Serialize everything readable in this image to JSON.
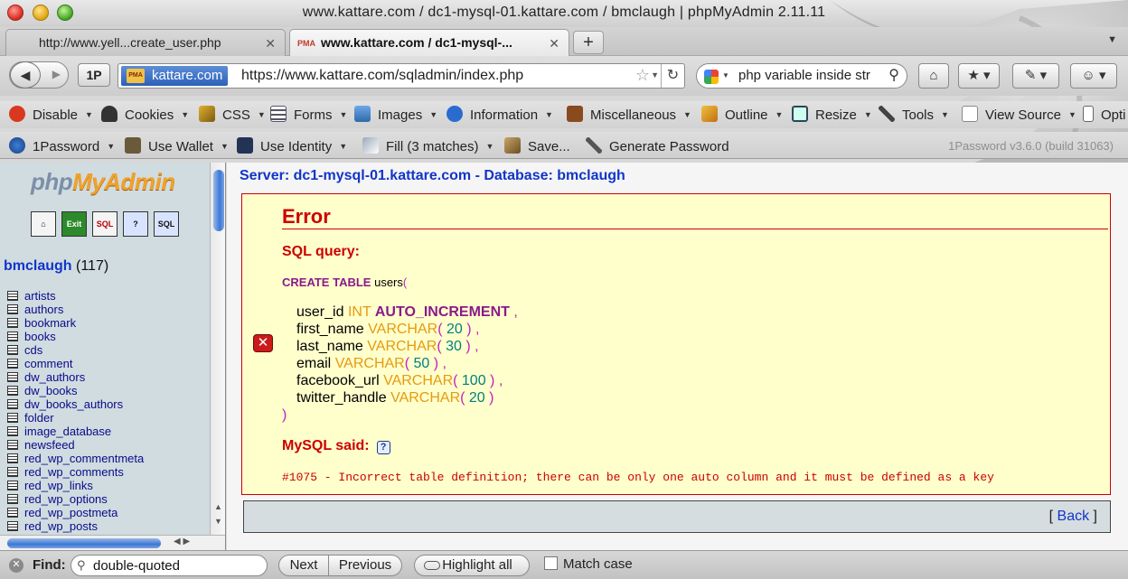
{
  "window": {
    "title": "www.kattare.com / dc1-mysql-01.kattare.com / bmclaugh | phpMyAdmin 2.11.11"
  },
  "tabs": [
    {
      "label": "http://www.yell...create_user.php",
      "active": false
    },
    {
      "label": "www.kattare.com / dc1-mysql-...",
      "active": true,
      "favicon": "PMA"
    }
  ],
  "navbar": {
    "onep_label": "1P",
    "identity": "kattare.com",
    "url": "https://www.kattare.com/sqladmin/index.php",
    "search_value": "php variable inside str"
  },
  "devtoolbar": {
    "items": [
      {
        "label": "Disable",
        "icon": "disable-icon"
      },
      {
        "label": "Cookies",
        "icon": "cookies-icon"
      },
      {
        "label": "CSS",
        "icon": "css-icon"
      },
      {
        "label": "Forms",
        "icon": "forms-icon"
      },
      {
        "label": "Images",
        "icon": "images-icon"
      },
      {
        "label": "Information",
        "icon": "information-icon"
      },
      {
        "label": "Miscellaneous",
        "icon": "miscellaneous-icon"
      },
      {
        "label": "Outline",
        "icon": "outline-icon"
      },
      {
        "label": "Resize",
        "icon": "resize-icon"
      },
      {
        "label": "Tools",
        "icon": "tools-icon"
      },
      {
        "label": "View Source",
        "icon": "view-source-icon"
      },
      {
        "label": "Opti",
        "icon": "options-icon"
      }
    ]
  },
  "pwbar": {
    "items": [
      {
        "label": "1Password",
        "icon": "1password-icon"
      },
      {
        "label": "Use Wallet",
        "icon": "wallet-icon"
      },
      {
        "label": "Use Identity",
        "icon": "identity-icon"
      },
      {
        "label": "Fill (3 matches)",
        "icon": "fill-icon"
      },
      {
        "label": "Save...",
        "icon": "save-icon"
      },
      {
        "label": "Generate Password",
        "icon": "generate-password-icon"
      }
    ],
    "version": "1Password v3.6.0 (build 31063)"
  },
  "leftframe": {
    "logo_part1": "php",
    "logo_part2": "MyAdmin",
    "db_name": "bmclaugh",
    "db_count": "(117)",
    "tables": [
      "artists",
      "authors",
      "bookmark",
      "books",
      "cds",
      "comment",
      "dw_authors",
      "dw_books",
      "dw_books_authors",
      "folder",
      "image_database",
      "newsfeed",
      "red_wp_commentmeta",
      "red_wp_comments",
      "red_wp_links",
      "red_wp_options",
      "red_wp_postmeta",
      "red_wp_posts"
    ]
  },
  "main": {
    "server_line": "Server: dc1-mysql-01.kattare.com - Database: bmclaugh",
    "error_title": "Error",
    "sql_query_label": "SQL query:",
    "sql": {
      "create": "CREATE TABLE",
      "table": "users",
      "open_paren": "(",
      "columns": [
        {
          "name": "user_id",
          "type": "INT",
          "extra": "AUTO_INCREMENT",
          "size": "",
          "sep": ","
        },
        {
          "name": "first_name",
          "type": "VARCHAR",
          "extra": "",
          "size": "20",
          "sep": ","
        },
        {
          "name": "last_name",
          "type": "VARCHAR",
          "extra": "",
          "size": "30",
          "sep": ","
        },
        {
          "name": "email",
          "type": "VARCHAR",
          "extra": "",
          "size": "50",
          "sep": ","
        },
        {
          "name": "facebook_url",
          "type": "VARCHAR",
          "extra": "",
          "size": "100",
          "sep": ","
        },
        {
          "name": "twitter_handle",
          "type": "VARCHAR",
          "extra": "",
          "size": "20",
          "sep": ""
        }
      ],
      "close_paren": ")"
    },
    "mysql_said_label": "MySQL said:",
    "help_glyph": "?",
    "error_message": "#1075 - Incorrect table definition; there can be only one auto column and it must be defined as a key",
    "back_open": "[ ",
    "back_label": "Back",
    "back_close": " ]"
  },
  "findbar": {
    "label": "Find:",
    "value": "double-quoted",
    "next": "Next",
    "previous": "Previous",
    "highlight": "Highlight all",
    "match_case": "Match case"
  },
  "colors": {
    "error_red": "#cc0000",
    "link_blue": "#1135c8",
    "error_bg": "#ffffcc",
    "left_bg": "#d0dce0"
  }
}
